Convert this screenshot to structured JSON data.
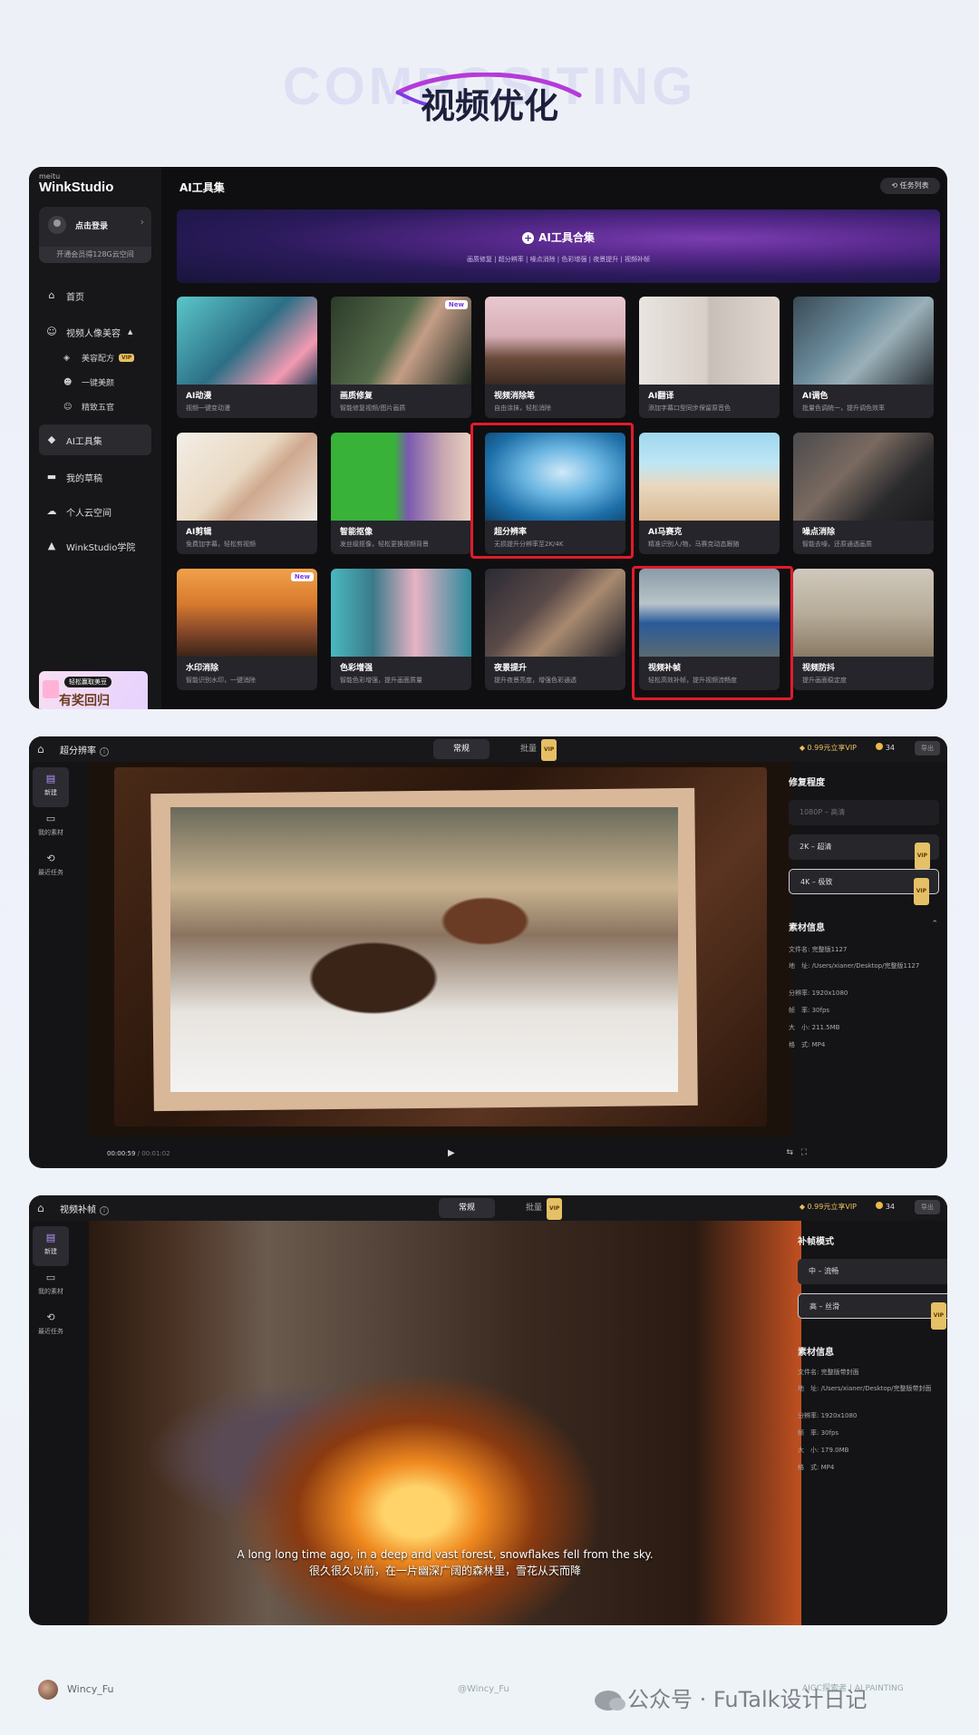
{
  "hero": {
    "ghost_text": "COMPOSITING",
    "title": "视频优化"
  },
  "panel1": {
    "brand_small": "meitu",
    "brand": "WinkStudio",
    "login_label": "点击登录",
    "login_tip": "开通会员得128G云空间",
    "nav": [
      {
        "label": "首页",
        "icon": "home-icon"
      },
      {
        "label": "视频人像美容",
        "icon": "face-icon"
      },
      {
        "label": "AI工具集",
        "icon": "cube-icon"
      },
      {
        "label": "我的草稿",
        "icon": "folder-icon"
      },
      {
        "label": "个人云空间",
        "icon": "cloud-icon"
      },
      {
        "label": "WinkStudio学院",
        "icon": "graduation-icon"
      }
    ],
    "sub_nav": [
      {
        "label": "美容配方",
        "vip": "VIP"
      },
      {
        "label": "一键美颜"
      },
      {
        "label": "精致五官"
      }
    ],
    "promo": {
      "pill": "轻松赢取美豆",
      "big": "有奖回归"
    },
    "page_title": "AI工具集",
    "task_button": "任务列表",
    "banner": {
      "title": "AI工具合集",
      "subtitle": "画质修复 | 超分辨率 | 噪点消除 | 色彩增强 | 夜景提升 | 视频补帧"
    },
    "cards": [
      {
        "name": "AI动漫",
        "desc": "视频一键变动漫"
      },
      {
        "name": "画质修复",
        "desc": "智能修复视频/图片画质",
        "badge": "New"
      },
      {
        "name": "视频消除笔",
        "desc": "自由涂抹，轻松消除"
      },
      {
        "name": "AI翻译",
        "desc": "添加字幕口型同步保留原音色"
      },
      {
        "name": "AI调色",
        "desc": "批量色调统一，提升调色效率"
      },
      {
        "name": "AI剪辑",
        "desc": "免费加字幕，轻松剪视频"
      },
      {
        "name": "智能抠像",
        "desc": "发丝级抠像，轻松更换视频背景"
      },
      {
        "name": "超分辨率",
        "desc": "无损提升分辨率至2K/4K"
      },
      {
        "name": "AI马赛克",
        "desc": "精准识别人/物，马赛克动态跟随"
      },
      {
        "name": "噪点消除",
        "desc": "智能去噪，还原通透画质"
      },
      {
        "name": "水印消除",
        "desc": "智能识别水印，一键消除",
        "badge": "New"
      },
      {
        "name": "色彩增强",
        "desc": "智能色彩增强，提升画面质量"
      },
      {
        "name": "夜景提升",
        "desc": "提升夜景亮度，增强色彩通透"
      },
      {
        "name": "视频补帧",
        "desc": "轻松高效补帧，提升视频流畅度"
      },
      {
        "name": "视频防抖",
        "desc": "提升画面稳定度"
      }
    ]
  },
  "panel2": {
    "title": "超分辨率",
    "tabs": [
      "常规",
      "批量"
    ],
    "tab_vip": "VIP",
    "vip_button": "0.99元立享VIP",
    "coins": "34",
    "export": "导出",
    "rail": [
      "新建",
      "我的素材",
      "最近任务"
    ],
    "section_title": "修复程度",
    "options": [
      {
        "label": "1080P – 高清",
        "disabled": true
      },
      {
        "label": "2K – 超清",
        "vip": "VIP"
      },
      {
        "label": "4K – 极致",
        "vip": "VIP",
        "selected": true
      }
    ],
    "meta_title": "素材信息",
    "meta": [
      "文件名: 完整版1127",
      "地　址: /Users/xianer/Desktop/完整版1127",
      "分辨率: 1920x1080",
      "帧　率: 30fps",
      "大　小: 211.5MB",
      "格　式: MP4"
    ],
    "time_current": "00:00:59",
    "time_total": " / 00:01:02"
  },
  "panel3": {
    "title": "视频补帧",
    "tabs": [
      "常规",
      "批量"
    ],
    "tab_vip": "VIP",
    "vip_button": "0.99元立享VIP",
    "coins": "34",
    "export": "导出",
    "rail": [
      "新建",
      "我的素材",
      "最近任务"
    ],
    "section_title": "补帧模式",
    "options": [
      {
        "label": "中 – 流畅"
      },
      {
        "label": "高 – 丝滑",
        "vip": "VIP",
        "selected": true
      }
    ],
    "meta_title": "素材信息",
    "meta": [
      "文件名: 完整版带封面",
      "地　址: /Users/xianer/Desktop/完整版带封面",
      "分辨率: 1920x1080",
      "帧　率: 30fps",
      "大　小: 179.0MB",
      "格　式: MP4"
    ],
    "caption_en": "A long long time ago, in a deep and vast forest, snowflakes fell from the sky.",
    "caption_zh": "很久很久以前，在一片幽深广阔的森林里，雪花从天而降"
  },
  "footer": {
    "author": "Wincy_Fu",
    "handle": "@Wincy_Fu",
    "right": "AIGC探索者 | AI PAINTING",
    "watermark": "公众号 · FuTalk设计日记"
  },
  "colors": {
    "highlight": "#e11b2a",
    "accent": "#7b3db0",
    "vip_gold": "#e6c066"
  }
}
